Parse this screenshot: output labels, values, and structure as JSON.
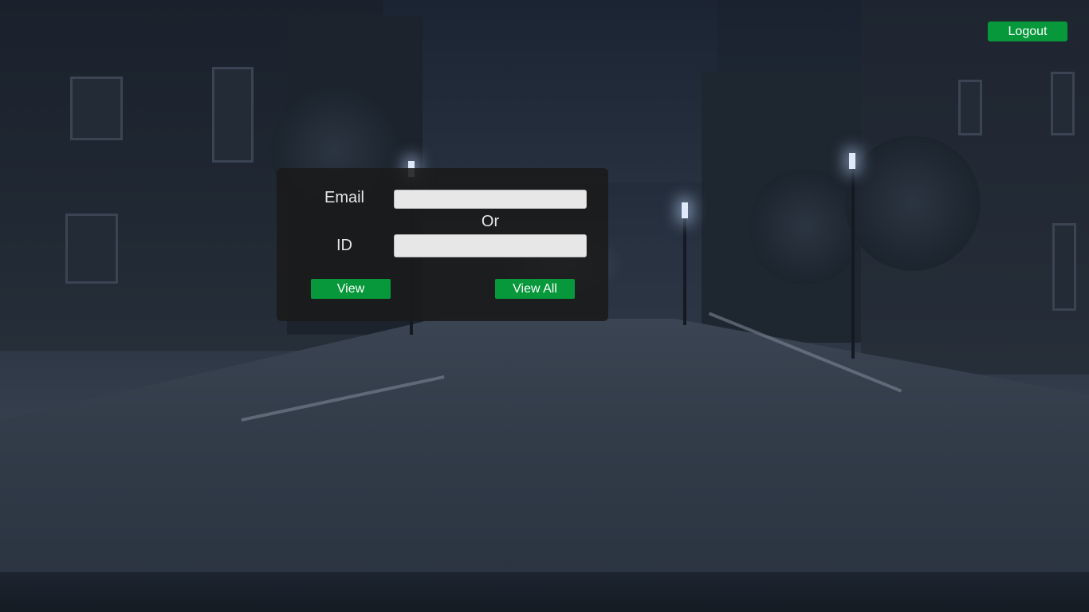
{
  "header": {
    "logout_label": "Logout"
  },
  "form": {
    "email_label": "Email",
    "email_value": "",
    "or_text": "Or",
    "id_label": "ID",
    "id_value": "",
    "view_label": "View",
    "view_all_label": "View All"
  },
  "colors": {
    "button_green": "#06983a",
    "panel_bg": "#1a1a1a",
    "input_bg": "#e7e7e7"
  }
}
